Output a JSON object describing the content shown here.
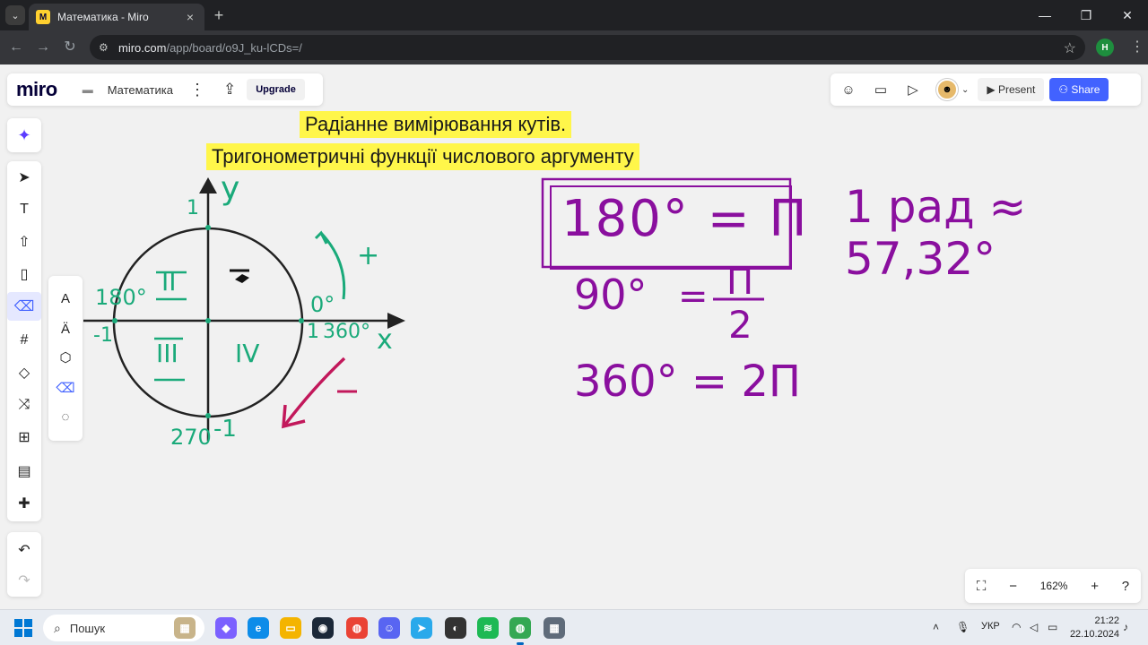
{
  "browser": {
    "tab_title": "Математика - Miro",
    "tab_favicon": "M",
    "url_host": "miro.com",
    "url_path": "/app/board/o9J_ku-lCDs=/",
    "profile_initial": "H"
  },
  "board": {
    "logo": "miro",
    "name": "Математика",
    "upgrade_label": "Upgrade",
    "present_label": "Present",
    "share_label": "Share",
    "zoom_level": "162%"
  },
  "content": {
    "title_line1": "Радіанне вимірювання кутів.",
    "title_line2": "Тригонометричні функції числового аргументу"
  },
  "handwriting": {
    "axis_y": "y",
    "axis_x": "x",
    "y_pos": "1",
    "y_neg": "-1",
    "x_neg": "-1",
    "x_pos": "1",
    "deg_0": "0°",
    "deg_180": "180°",
    "deg_360": "360°",
    "deg_270": "270",
    "quadrant_1": "I",
    "quadrant_2": "II",
    "quadrant_3": "III",
    "quadrant_4": "IV",
    "plus": "+",
    "minus": "−",
    "eq1": "180° = П",
    "eq2_left": "90°",
    "eq2_eq": "=",
    "eq2_num": "П",
    "eq2_den": "2",
    "eq3": "360° = 2П",
    "rad": "1 рад ≈ 57,32°",
    "color_green": "#1aaa7a",
    "color_purple": "#8a0f9e",
    "color_pink": "#c2185b"
  },
  "taskbar": {
    "search_placeholder": "Пошук",
    "language": "УКР",
    "time": "21:22",
    "date": "22.10.2024"
  }
}
